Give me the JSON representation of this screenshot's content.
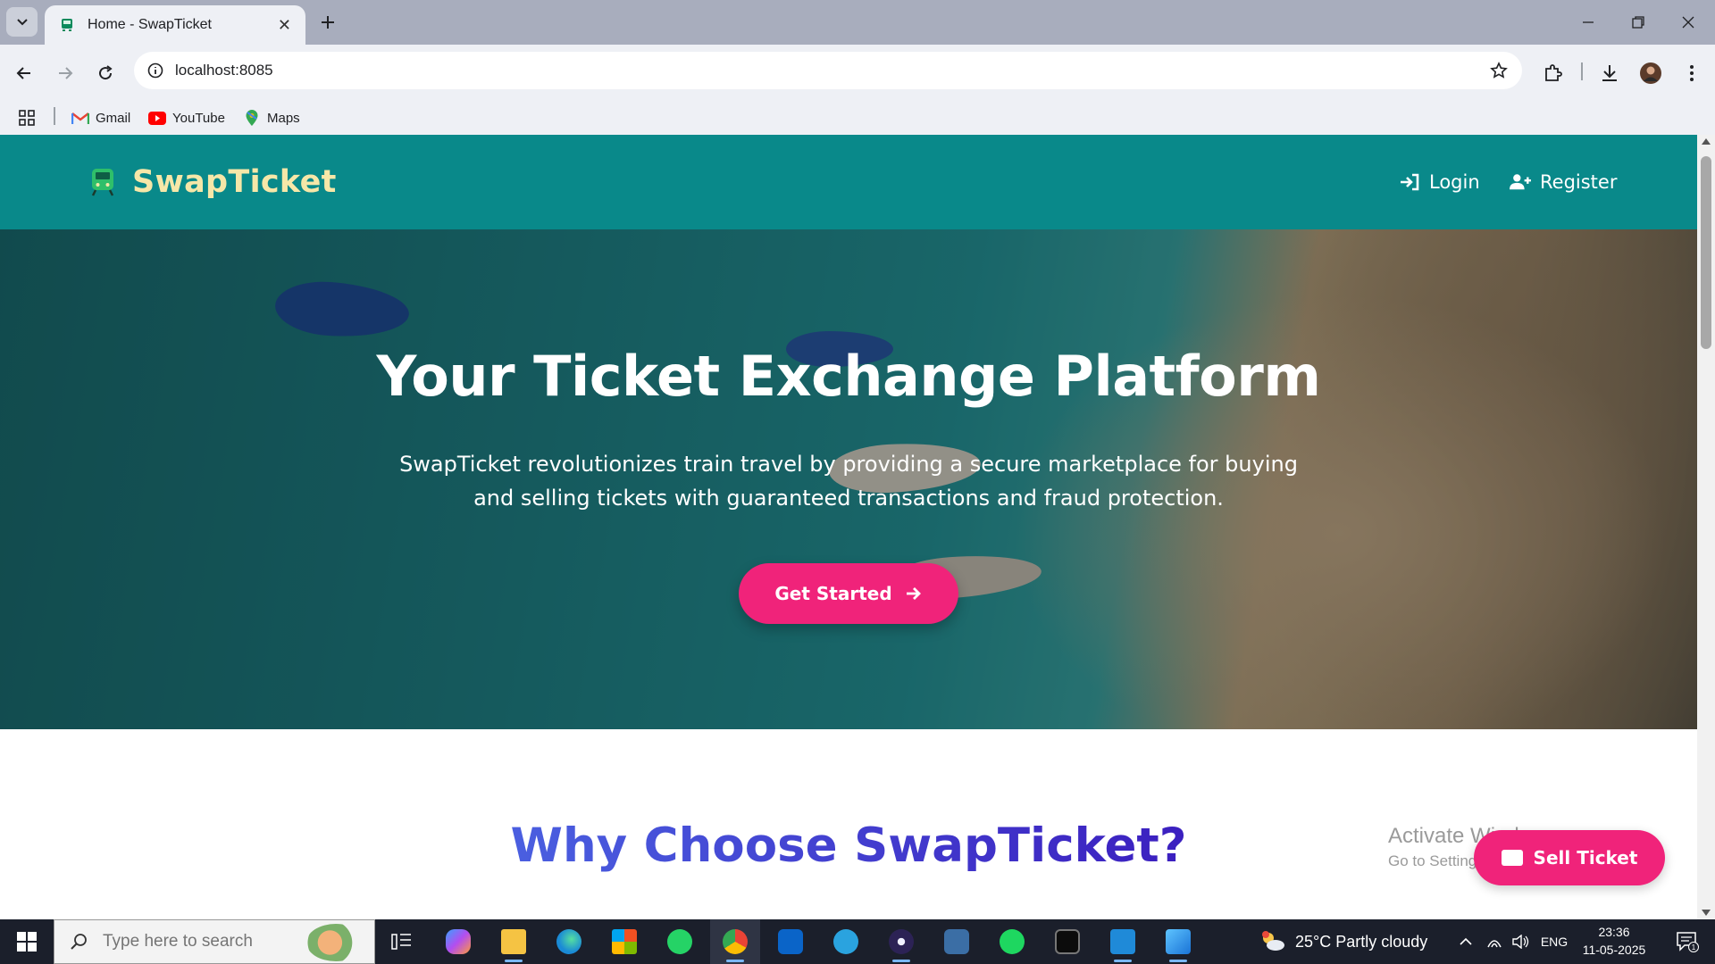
{
  "browser": {
    "tab_title": "Home - SwapTicket",
    "tab_close": "✕",
    "new_tab": "+",
    "url": "localhost:8085",
    "bookmarks": [
      {
        "label": "Gmail",
        "icon": "gmail-icon"
      },
      {
        "label": "YouTube",
        "icon": "youtube-icon"
      },
      {
        "label": "Maps",
        "icon": "maps-icon"
      }
    ]
  },
  "site": {
    "brand": "SwapTicket",
    "nav": {
      "login": "Login",
      "register": "Register"
    },
    "hero": {
      "title": "Your Ticket Exchange Platform",
      "subtitle": "SwapTicket revolutionizes train travel by providing a secure marketplace for buying and selling tickets with guaranteed transactions and fraud protection.",
      "cta": "Get Started"
    },
    "why_title": "Why Choose SwapTicket?",
    "sell_button": "Sell Ticket"
  },
  "watermark": {
    "line1": "Activate Windows",
    "line2": "Go to Settings to activate Windows."
  },
  "taskbar": {
    "search_placeholder": "Type here to search",
    "weather": "25°C  Partly cloudy",
    "language": "ENG",
    "time": "23:36",
    "date": "11-05-2025",
    "notification_count": "1"
  },
  "colors": {
    "header_bg": "#09898a",
    "brand_text": "#f6e7a8",
    "accent_pink": "#f0237a",
    "why_gradient_start": "#4a5fe0",
    "why_gradient_end": "#3b1fbf"
  }
}
